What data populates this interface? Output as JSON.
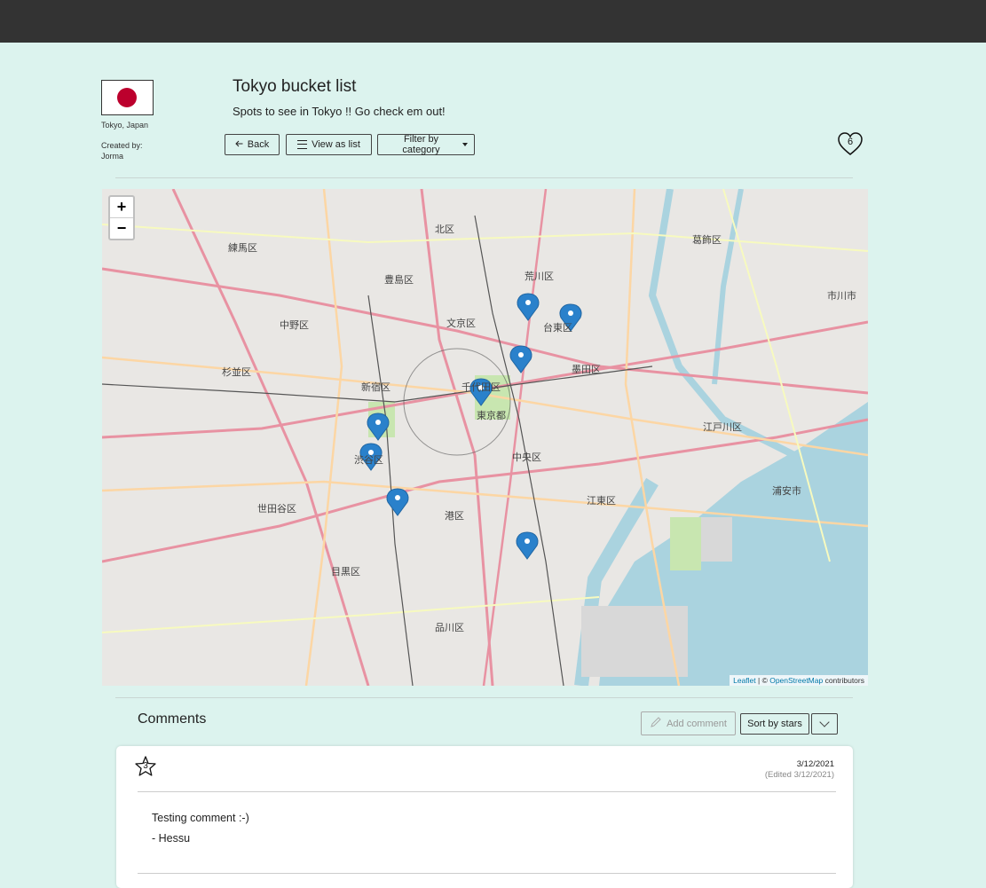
{
  "header": {
    "brand_color": "#333333"
  },
  "list": {
    "flag_country": "Japan",
    "location": "Tokyo, Japan",
    "created_by_label": "Created by:",
    "creator": "Jorma",
    "title": "Tokyo bucket list",
    "description": "Spots to see in Tokyo !! Go check em out!",
    "likes": "6"
  },
  "toolbar": {
    "back_label": "Back",
    "view_list_label": "View as list",
    "filter_label": "Filter by category"
  },
  "map": {
    "zoom_in": "+",
    "zoom_out": "−",
    "attribution_leaflet": "Leaflet",
    "attribution_sep": " | © ",
    "attribution_osm": "OpenStreetMap",
    "attribution_tail": " contributors",
    "markers": 8,
    "labels": [
      "練馬区",
      "北区",
      "荒川区",
      "葛飾区",
      "豊島区",
      "文京区",
      "台東区",
      "中野区",
      "杉並区",
      "新宿区",
      "千代田区",
      "墨田区",
      "東京都",
      "江戸川区",
      "渋谷区",
      "中央区",
      "江東区",
      "世田谷区",
      "港区",
      "浦安市",
      "目黒区",
      "品川区",
      "市川市"
    ]
  },
  "comments": {
    "title": "Comments",
    "add_label": "Add comment",
    "sort_label": "Sort by stars",
    "items": [
      {
        "stars": "3",
        "date": "3/12/2021",
        "edited": "(Edited 3/12/2021)",
        "text": "Testing comment :-)",
        "author": "- Hessu"
      }
    ]
  }
}
